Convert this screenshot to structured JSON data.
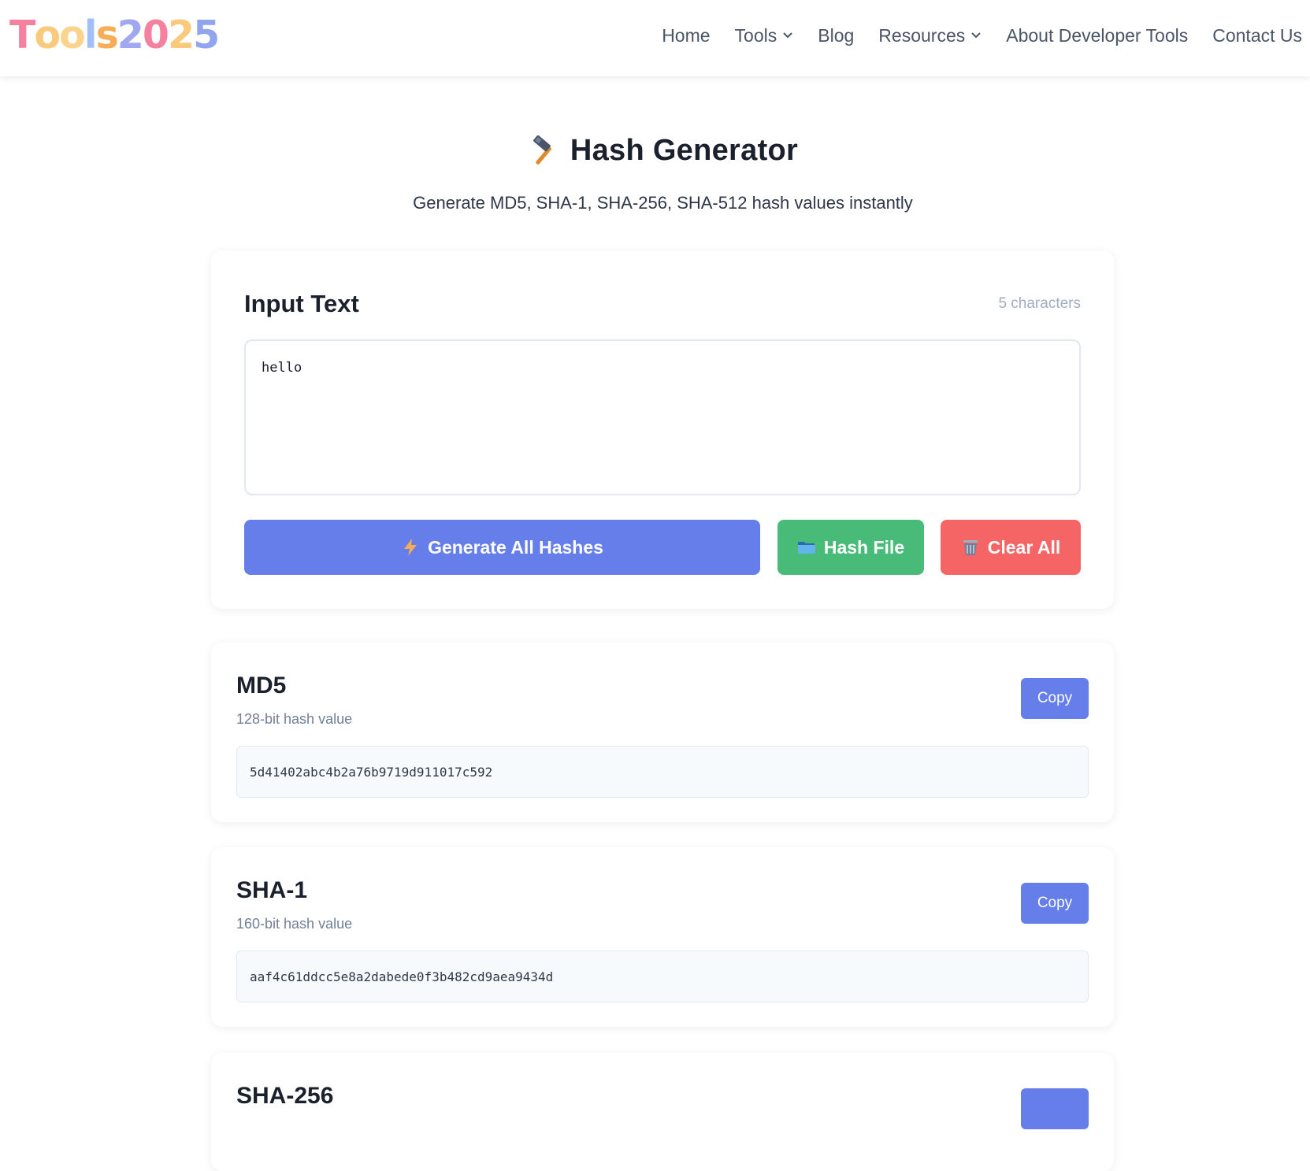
{
  "logo": {
    "letters": [
      {
        "ch": "T",
        "color": "#f6819e"
      },
      {
        "ch": "o",
        "color": "#f9c97c"
      },
      {
        "ch": "o",
        "color": "#fbd38d"
      },
      {
        "ch": "l",
        "color": "#a3bffa"
      },
      {
        "ch": "s",
        "color": "#f6ad55"
      },
      {
        "ch": "2",
        "color": "#9fa8f0"
      },
      {
        "ch": "0",
        "color": "#f6819e"
      },
      {
        "ch": "2",
        "color": "#f9c97c"
      },
      {
        "ch": "5",
        "color": "#90a4f0"
      }
    ]
  },
  "nav": {
    "home": "Home",
    "tools": "Tools",
    "blog": "Blog",
    "resources": "Resources",
    "about": "About Developer Tools",
    "contact": "Contact Us"
  },
  "page": {
    "title": "Hash Generator",
    "title_icon": "hammer-icon",
    "subtitle": "Generate MD5, SHA-1, SHA-256, SHA-512 hash values instantly"
  },
  "input": {
    "label": "Input Text",
    "char_count": "5 characters",
    "value": "hello"
  },
  "buttons": {
    "generate": "Generate All Hashes",
    "hash_file": "Hash File",
    "clear": "Clear All"
  },
  "colors": {
    "primary": "#667eea",
    "success": "#48bb78",
    "danger": "#f56565"
  },
  "hashes": [
    {
      "name": "MD5",
      "desc": "128-bit hash value",
      "value": "5d41402abc4b2a76b9719d911017c592",
      "copy": "Copy"
    },
    {
      "name": "SHA-1",
      "desc": "160-bit hash value",
      "value": "aaf4c61ddcc5e8a2dabede0f3b482cd9aea9434d",
      "copy": "Copy"
    },
    {
      "name": "SHA-256",
      "desc": "",
      "value": "",
      "copy": ""
    }
  ]
}
